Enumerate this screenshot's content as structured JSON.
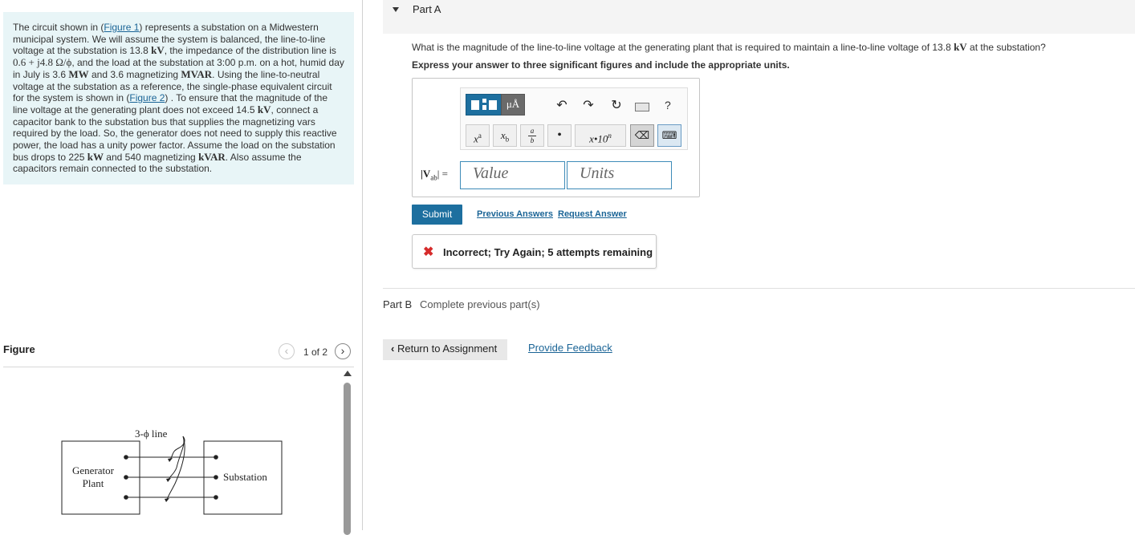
{
  "problem": {
    "intro": "The circuit shown in (",
    "fig1_link": "Figure 1",
    "t1": ") represents a substation on a Midwestern municipal system. We will assume the system is balanced, the line-to-line voltage at the substation is 13.8 ",
    "kv1": "kV",
    "t2": ", the impedance of the distribution line is ",
    "impedance": "0.6 + j4.8 Ω/ϕ",
    "t3": ", and the load at the substation at 3:00 p.m. on a hot, humid day in July is 3.6 ",
    "mw": "MW",
    "t4": " and 3.6 magnetizing ",
    "mvar": "MVAR",
    "t5": ". Using the line-to-neutral voltage at the substation as a reference, the single-phase equivalent circuit for the system is shown in (",
    "fig2_link": "Figure 2",
    "t6": ") . To ensure that the magnitude of the line voltage at the generating plant does not exceed 14.5 ",
    "kv2": "kV",
    "t7": ", connect a capacitor bank to the substation bus that supplies the magnetizing vars required by the load. So, the generator does not need to supply this reactive power, the load has a unity power factor. Assume the load on the substation bus drops to 225 ",
    "kw": "kW",
    "t8": " and 540 magnetizing ",
    "kvar": "kVAR",
    "t9": ". Also assume the capacitors remain connected to the substation."
  },
  "figure": {
    "title": "Figure",
    "counter": "1 of 2",
    "prev_icon": "chevron-left-icon",
    "next_icon": "chevron-right-icon",
    "line_label": "3-ϕ line",
    "generator_label_1": "Generator",
    "generator_label_2": "Plant",
    "substation_label": "Substation"
  },
  "part_a": {
    "label": "Part A",
    "question_pre": "What is the magnitude of the line-to-line voltage at the generating plant that is required to maintain a line-to-line voltage of 13.8 ",
    "question_unit": "kV",
    "question_post": " at the substation?",
    "instruction": "Express your answer to three significant figures and include the appropriate units.",
    "toolbar": {
      "units_button": "μÅ",
      "help": "?",
      "superscript": "x",
      "superscript_sup": "a",
      "subscript": "x",
      "subscript_sub": "b",
      "fraction_num": "a",
      "fraction_den": "b",
      "dot": "•",
      "scinot": "x•10",
      "scinot_sup": "n"
    },
    "answer_label": "|V",
    "answer_label_sub": "ab",
    "answer_label_end": "| =",
    "value_placeholder": "Value",
    "units_placeholder": "Units",
    "submit": "Submit",
    "previous_answers": "Previous Answers",
    "request_answer": "Request Answer",
    "feedback": "Incorrect; Try Again; 5 attempts remaining"
  },
  "part_b": {
    "label": "Part B",
    "status": "Complete previous part(s)"
  },
  "footer": {
    "return": "Return to Assignment",
    "provide_feedback": "Provide Feedback"
  },
  "colors": {
    "accent": "#1d6f9f",
    "problem_bg": "#e8f5f7",
    "error": "#d62b2b"
  }
}
